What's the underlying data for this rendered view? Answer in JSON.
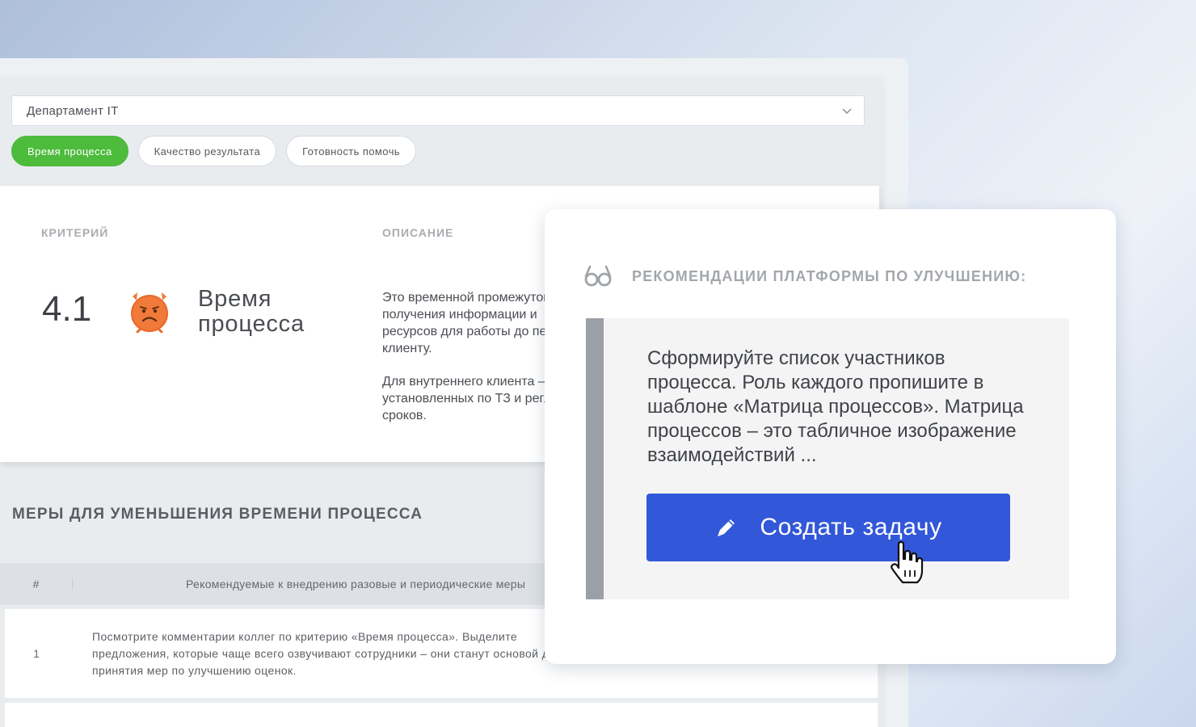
{
  "header": {
    "department_select": {
      "value": "Департамент IT"
    },
    "tabs": [
      {
        "label": "Время процесса",
        "active": true
      },
      {
        "label": "Качество результата",
        "active": false
      },
      {
        "label": "Готовность помочь",
        "active": false
      }
    ]
  },
  "criterion": {
    "column_criterion": "КРИТЕРИЙ",
    "column_description": "ОПИСАНИЕ",
    "score": "4.1",
    "name_line1": "Время",
    "name_line2": "процесса",
    "status_icon": "sad-alarm-clock-icon",
    "description": [
      "Это временной промежуток с момента",
      "получения информации и",
      "ресурсов для работы до передачи",
      "клиенту."
    ],
    "description2": [
      "Для внутреннего клиента – соблюдение",
      "установленных по ТЗ и регламентам",
      "сроков."
    ]
  },
  "measures": {
    "title": "МЕРЫ ДЛЯ УМЕНЬШЕНИЯ ВРЕМЕНИ ПРОЦЕССА",
    "columns": [
      "#",
      "Рекомендуемые к внедрению разовые и периодические меры"
    ],
    "rows": [
      {
        "num": "1",
        "lines": [
          "Посмотрите комментарии коллег по критерию «Время процесса». Выделите",
          "предложения, которые чаще всего озвучивают сотрудники – они станут основой для",
          "принятия мер по улучшению оценок."
        ]
      }
    ]
  },
  "recommendations": {
    "icon": "glasses-icon",
    "title": "РЕКОМЕНДАЦИИ ПЛАТФОРМЫ ПО УЛУЧШЕНИЮ:",
    "text": "Сформируйте список участников процесса. Роль каждого пропишите в шаблоне «Матрица процессов». Матрица процессов – это табличное изображение взаимодействий ...",
    "create_task_label": "Создать задачу"
  },
  "colors": {
    "accent_green": "#4dbb3c",
    "button_blue": "#3257d9",
    "warning_orange": "#f07a3a"
  }
}
